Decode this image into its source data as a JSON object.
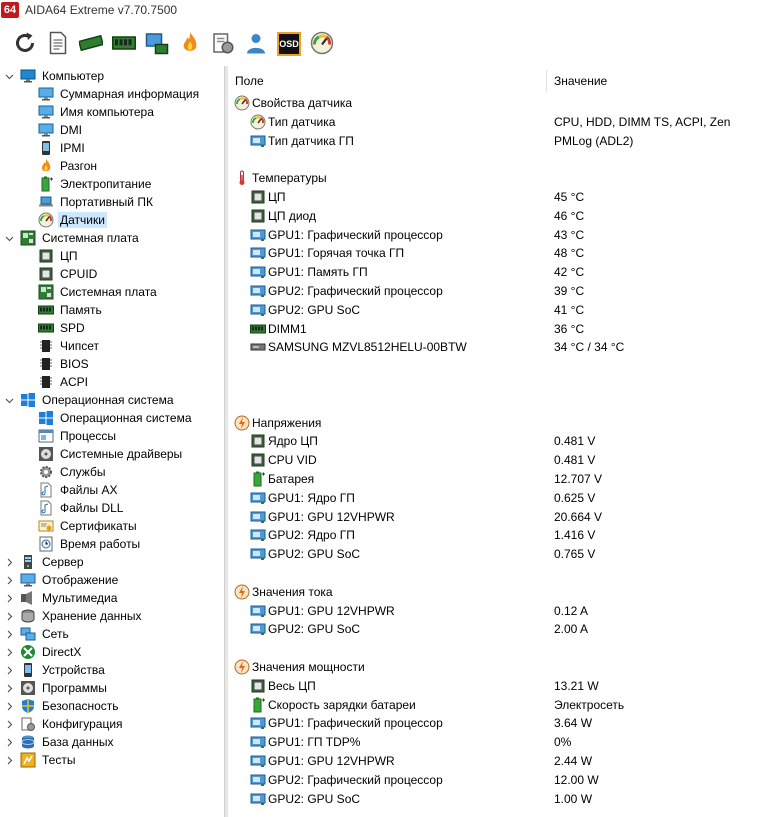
{
  "window": {
    "logo": "64",
    "title": "AIDA64 Extreme v7.70.7500"
  },
  "toolbar": {
    "buttons": [
      {
        "icon": "refresh-icon"
      },
      {
        "icon": "report-icon"
      },
      {
        "icon": "memory-module-icon"
      },
      {
        "icon": "memory-chip-icon"
      },
      {
        "icon": "network-audit-icon"
      },
      {
        "icon": "flame-icon"
      },
      {
        "icon": "system-config-icon"
      },
      {
        "icon": "user-icon"
      },
      {
        "icon": "osd-icon",
        "label": "OSD"
      },
      {
        "icon": "gauge-icon"
      }
    ]
  },
  "tree": {
    "items": [
      {
        "label": "Компьютер",
        "level": 0,
        "expander": "open",
        "icon": "computer-icon"
      },
      {
        "label": "Суммарная информация",
        "level": 1,
        "icon": "monitor-icon"
      },
      {
        "label": "Имя компьютера",
        "level": 1,
        "icon": "monitor-icon"
      },
      {
        "label": "DMI",
        "level": 1,
        "icon": "monitor-icon"
      },
      {
        "label": "IPMI",
        "level": 1,
        "icon": "phone-icon"
      },
      {
        "label": "Разгон",
        "level": 1,
        "icon": "flame-icon"
      },
      {
        "label": "Электропитание",
        "level": 1,
        "icon": "battery-icon"
      },
      {
        "label": "Портативный ПК",
        "level": 1,
        "icon": "laptop-icon"
      },
      {
        "label": "Датчики",
        "level": 1,
        "icon": "gauge-icon",
        "selected": true
      },
      {
        "label": "Системная плата",
        "level": 0,
        "expander": "open",
        "icon": "motherboard-icon"
      },
      {
        "label": "ЦП",
        "level": 1,
        "icon": "cpu-icon"
      },
      {
        "label": "CPUID",
        "level": 1,
        "icon": "cpu-icon"
      },
      {
        "label": "Системная плата",
        "level": 1,
        "icon": "motherboard-icon"
      },
      {
        "label": "Память",
        "level": 1,
        "icon": "memory-icon"
      },
      {
        "label": "SPD",
        "level": 1,
        "icon": "memory-icon"
      },
      {
        "label": "Чипсет",
        "level": 1,
        "icon": "chip-icon"
      },
      {
        "label": "BIOS",
        "level": 1,
        "icon": "chip-icon"
      },
      {
        "label": "ACPI",
        "level": 1,
        "icon": "chip-icon"
      },
      {
        "label": "Операционная система",
        "level": 0,
        "expander": "open",
        "icon": "windows-icon"
      },
      {
        "label": "Операционная система",
        "level": 1,
        "icon": "windows-icon"
      },
      {
        "label": "Процессы",
        "level": 1,
        "icon": "window-icon"
      },
      {
        "label": "Системные драйверы",
        "level": 1,
        "icon": "disc-icon"
      },
      {
        "label": "Службы",
        "level": 1,
        "icon": "gear-icon"
      },
      {
        "label": "Файлы AX",
        "level": 1,
        "icon": "file-icon"
      },
      {
        "label": "Файлы DLL",
        "level": 1,
        "icon": "file-icon"
      },
      {
        "label": "Сертификаты",
        "level": 1,
        "icon": "certificate-icon"
      },
      {
        "label": "Время работы",
        "level": 1,
        "icon": "clock-icon"
      },
      {
        "label": "Сервер",
        "level": 0,
        "expander": "closed",
        "icon": "server-icon"
      },
      {
        "label": "Отображение",
        "level": 0,
        "expander": "closed",
        "icon": "monitor-icon"
      },
      {
        "label": "Мультимедиа",
        "level": 0,
        "expander": "closed",
        "icon": "speaker-icon"
      },
      {
        "label": "Хранение данных",
        "level": 0,
        "expander": "closed",
        "icon": "storage-icon"
      },
      {
        "label": "Сеть",
        "level": 0,
        "expander": "closed",
        "icon": "network-icon"
      },
      {
        "label": "DirectX",
        "level": 0,
        "expander": "closed",
        "icon": "xbox-icon"
      },
      {
        "label": "Устройства",
        "level": 0,
        "expander": "closed",
        "icon": "phone-icon"
      },
      {
        "label": "Программы",
        "level": 0,
        "expander": "closed",
        "icon": "disc-icon"
      },
      {
        "label": "Безопасность",
        "level": 0,
        "expander": "closed",
        "icon": "shield-icon"
      },
      {
        "label": "Конфигурация",
        "level": 0,
        "expander": "closed",
        "icon": "config-icon"
      },
      {
        "label": "База данных",
        "level": 0,
        "expander": "closed",
        "icon": "database-icon"
      },
      {
        "label": "Тесты",
        "level": 0,
        "expander": "closed",
        "icon": "benchmark-icon"
      }
    ]
  },
  "detail": {
    "columns": {
      "field": "Поле",
      "value": "Значение"
    },
    "rows": [
      {
        "type": "group",
        "icon": "gauge-icon",
        "label": "Свойства датчика"
      },
      {
        "type": "item",
        "icon": "gauge-icon",
        "field": "Тип датчика",
        "value": "CPU, HDD, DIMM TS, ACPI, Zen"
      },
      {
        "type": "item",
        "icon": "gpu-icon",
        "field": "Тип датчика ГП",
        "value": "PMLog  (ADL2)"
      },
      {
        "type": "spacer"
      },
      {
        "type": "group",
        "icon": "thermometer-icon",
        "label": "Температуры"
      },
      {
        "type": "item",
        "icon": "cpu-icon",
        "field": "ЦП",
        "value": "45 °C"
      },
      {
        "type": "item",
        "icon": "cpu-icon",
        "field": "ЦП диод",
        "value": "46 °C"
      },
      {
        "type": "item",
        "icon": "gpu-icon",
        "field": "GPU1: Графический процессор",
        "value": "43 °C"
      },
      {
        "type": "item",
        "icon": "gpu-icon",
        "field": "GPU1: Горячая точка ГП",
        "value": "48 °C"
      },
      {
        "type": "item",
        "icon": "gpu-icon",
        "field": "GPU1: Память ГП",
        "value": "42 °C"
      },
      {
        "type": "item",
        "icon": "gpu-icon",
        "field": "GPU2: Графический процессор",
        "value": "39 °C"
      },
      {
        "type": "item",
        "icon": "gpu-icon",
        "field": "GPU2: GPU SoC",
        "value": "41 °C"
      },
      {
        "type": "item",
        "icon": "memory-icon",
        "field": "DIMM1",
        "value": "36 °C"
      },
      {
        "type": "item",
        "icon": "drive-icon",
        "field": "SAMSUNG MZVL8512HELU-00BTW",
        "value": "34 °C / 34 °C"
      },
      {
        "type": "spacer"
      },
      {
        "type": "spacer"
      },
      {
        "type": "spacer"
      },
      {
        "type": "group",
        "icon": "bolt-icon",
        "label": "Напряжения"
      },
      {
        "type": "item",
        "icon": "cpu-icon",
        "field": "Ядро ЦП",
        "value": "0.481 V"
      },
      {
        "type": "item",
        "icon": "cpu-icon",
        "field": "CPU VID",
        "value": "0.481 V"
      },
      {
        "type": "item",
        "icon": "battery-icon",
        "field": "Батарея",
        "value": "12.707 V"
      },
      {
        "type": "item",
        "icon": "gpu-icon",
        "field": "GPU1: Ядро ГП",
        "value": "0.625 V"
      },
      {
        "type": "item",
        "icon": "gpu-icon",
        "field": "GPU1: GPU 12VHPWR",
        "value": "20.664 V"
      },
      {
        "type": "item",
        "icon": "gpu-icon",
        "field": "GPU2: Ядро ГП",
        "value": "1.416 V"
      },
      {
        "type": "item",
        "icon": "gpu-icon",
        "field": "GPU2: GPU SoC",
        "value": "0.765 V"
      },
      {
        "type": "spacer"
      },
      {
        "type": "group",
        "icon": "bolt-icon",
        "label": "Значения тока"
      },
      {
        "type": "item",
        "icon": "gpu-icon",
        "field": "GPU1: GPU 12VHPWR",
        "value": "0.12 A"
      },
      {
        "type": "item",
        "icon": "gpu-icon",
        "field": "GPU2: GPU SoC",
        "value": "2.00 A"
      },
      {
        "type": "spacer"
      },
      {
        "type": "group",
        "icon": "bolt-icon",
        "label": "Значения мощности"
      },
      {
        "type": "item",
        "icon": "cpu-icon",
        "field": "Весь ЦП",
        "value": "13.21 W"
      },
      {
        "type": "item",
        "icon": "battery-icon",
        "field": "Скорость зарядки батареи",
        "value": "Электросеть"
      },
      {
        "type": "item",
        "icon": "gpu-icon",
        "field": "GPU1: Графический процессор",
        "value": "3.64 W"
      },
      {
        "type": "item",
        "icon": "gpu-icon",
        "field": "GPU1: ГП TDP%",
        "value": "0%"
      },
      {
        "type": "item",
        "icon": "gpu-icon",
        "field": "GPU1: GPU 12VHPWR",
        "value": "2.44 W"
      },
      {
        "type": "item",
        "icon": "gpu-icon",
        "field": "GPU2: Графический процессор",
        "value": "12.00 W"
      },
      {
        "type": "item",
        "icon": "gpu-icon",
        "field": "GPU2: GPU SoC",
        "value": "1.00 W"
      }
    ]
  },
  "colors": {
    "selection": "#cce8ff",
    "logo": "#c21a1a",
    "accent": "#1e88d2"
  }
}
